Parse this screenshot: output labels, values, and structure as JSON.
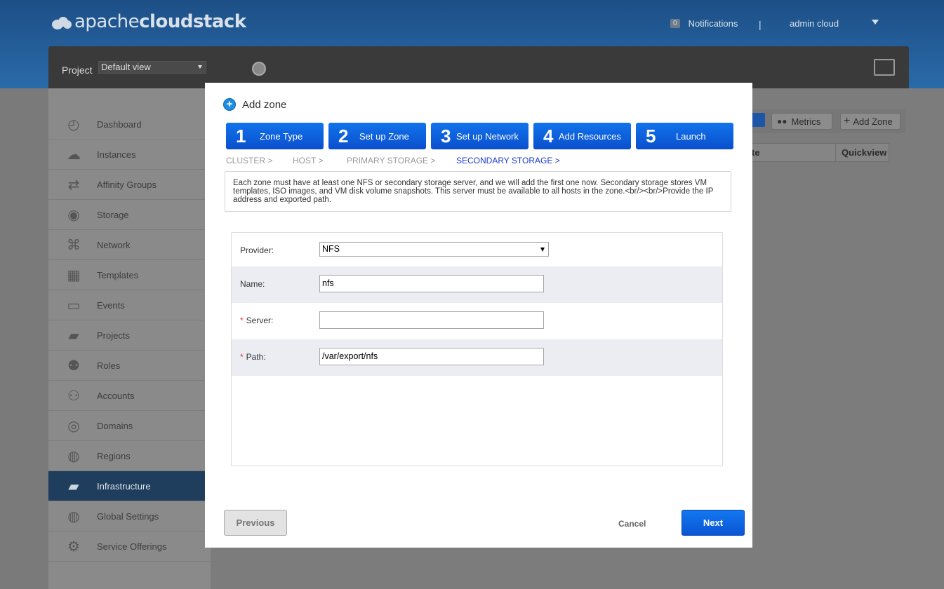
{
  "app": {
    "logo_text_light": "apache",
    "logo_text_bold": "cloudstack",
    "notifications_count": "0",
    "notifications_label": "Notifications",
    "separator": "|",
    "user": "admin cloud"
  },
  "project": {
    "label": "Project",
    "selected": "Default view"
  },
  "sidebar": {
    "items": [
      {
        "label": "Dashboard",
        "icon": "dashboard-icon"
      },
      {
        "label": "Instances",
        "icon": "cloud-icon"
      },
      {
        "label": "Affinity Groups",
        "icon": "affinity-icon"
      },
      {
        "label": "Storage",
        "icon": "disk-icon"
      },
      {
        "label": "Network",
        "icon": "network-icon"
      },
      {
        "label": "Templates",
        "icon": "templates-icon"
      },
      {
        "label": "Events",
        "icon": "calendar-icon"
      },
      {
        "label": "Projects",
        "icon": "folder-icon"
      },
      {
        "label": "Roles",
        "icon": "roles-icon"
      },
      {
        "label": "Accounts",
        "icon": "user-icon"
      },
      {
        "label": "Domains",
        "icon": "domains-icon"
      },
      {
        "label": "Regions",
        "icon": "globe-icon"
      },
      {
        "label": "Infrastructure",
        "icon": "infrastructure-icon"
      },
      {
        "label": "Global Settings",
        "icon": "globe-settings-icon"
      },
      {
        "label": "Service Offerings",
        "icon": "gear-icon"
      }
    ],
    "active_index": 12
  },
  "toolbar": {
    "metrics_label": "Metrics",
    "add_zone_label": "Add Zone"
  },
  "table": {
    "col_partial": "te",
    "col_quickview": "Quickview"
  },
  "dialog": {
    "title": "Add zone",
    "steps": [
      {
        "num": "1",
        "label": "Zone Type"
      },
      {
        "num": "2",
        "label": "Set up Zone"
      },
      {
        "num": "3",
        "label": "Set up Network"
      },
      {
        "num": "4",
        "label": "Add Resources"
      },
      {
        "num": "5",
        "label": "Launch"
      }
    ],
    "substeps": [
      "CLUSTER  >",
      "HOST  >",
      "PRIMARY STORAGE  >",
      "SECONDARY STORAGE  >"
    ],
    "description": "Each zone must have at least one NFS or secondary storage server, and we will add the first one now. Secondary storage stores VM templates, ISO images, and VM disk volume snapshots. This server must be available to all hosts in the zone.<br/><br/>Provide the IP address and exported path.",
    "form": {
      "provider_label": "Provider:",
      "provider_value": "NFS",
      "name_label": "Name:",
      "name_value": "nfs",
      "server_label": "Server:",
      "server_value": "",
      "path_label": "Path:",
      "path_value": "/var/export/nfs",
      "required_mark": "*"
    },
    "buttons": {
      "previous": "Previous",
      "cancel": "Cancel",
      "next": "Next"
    }
  }
}
